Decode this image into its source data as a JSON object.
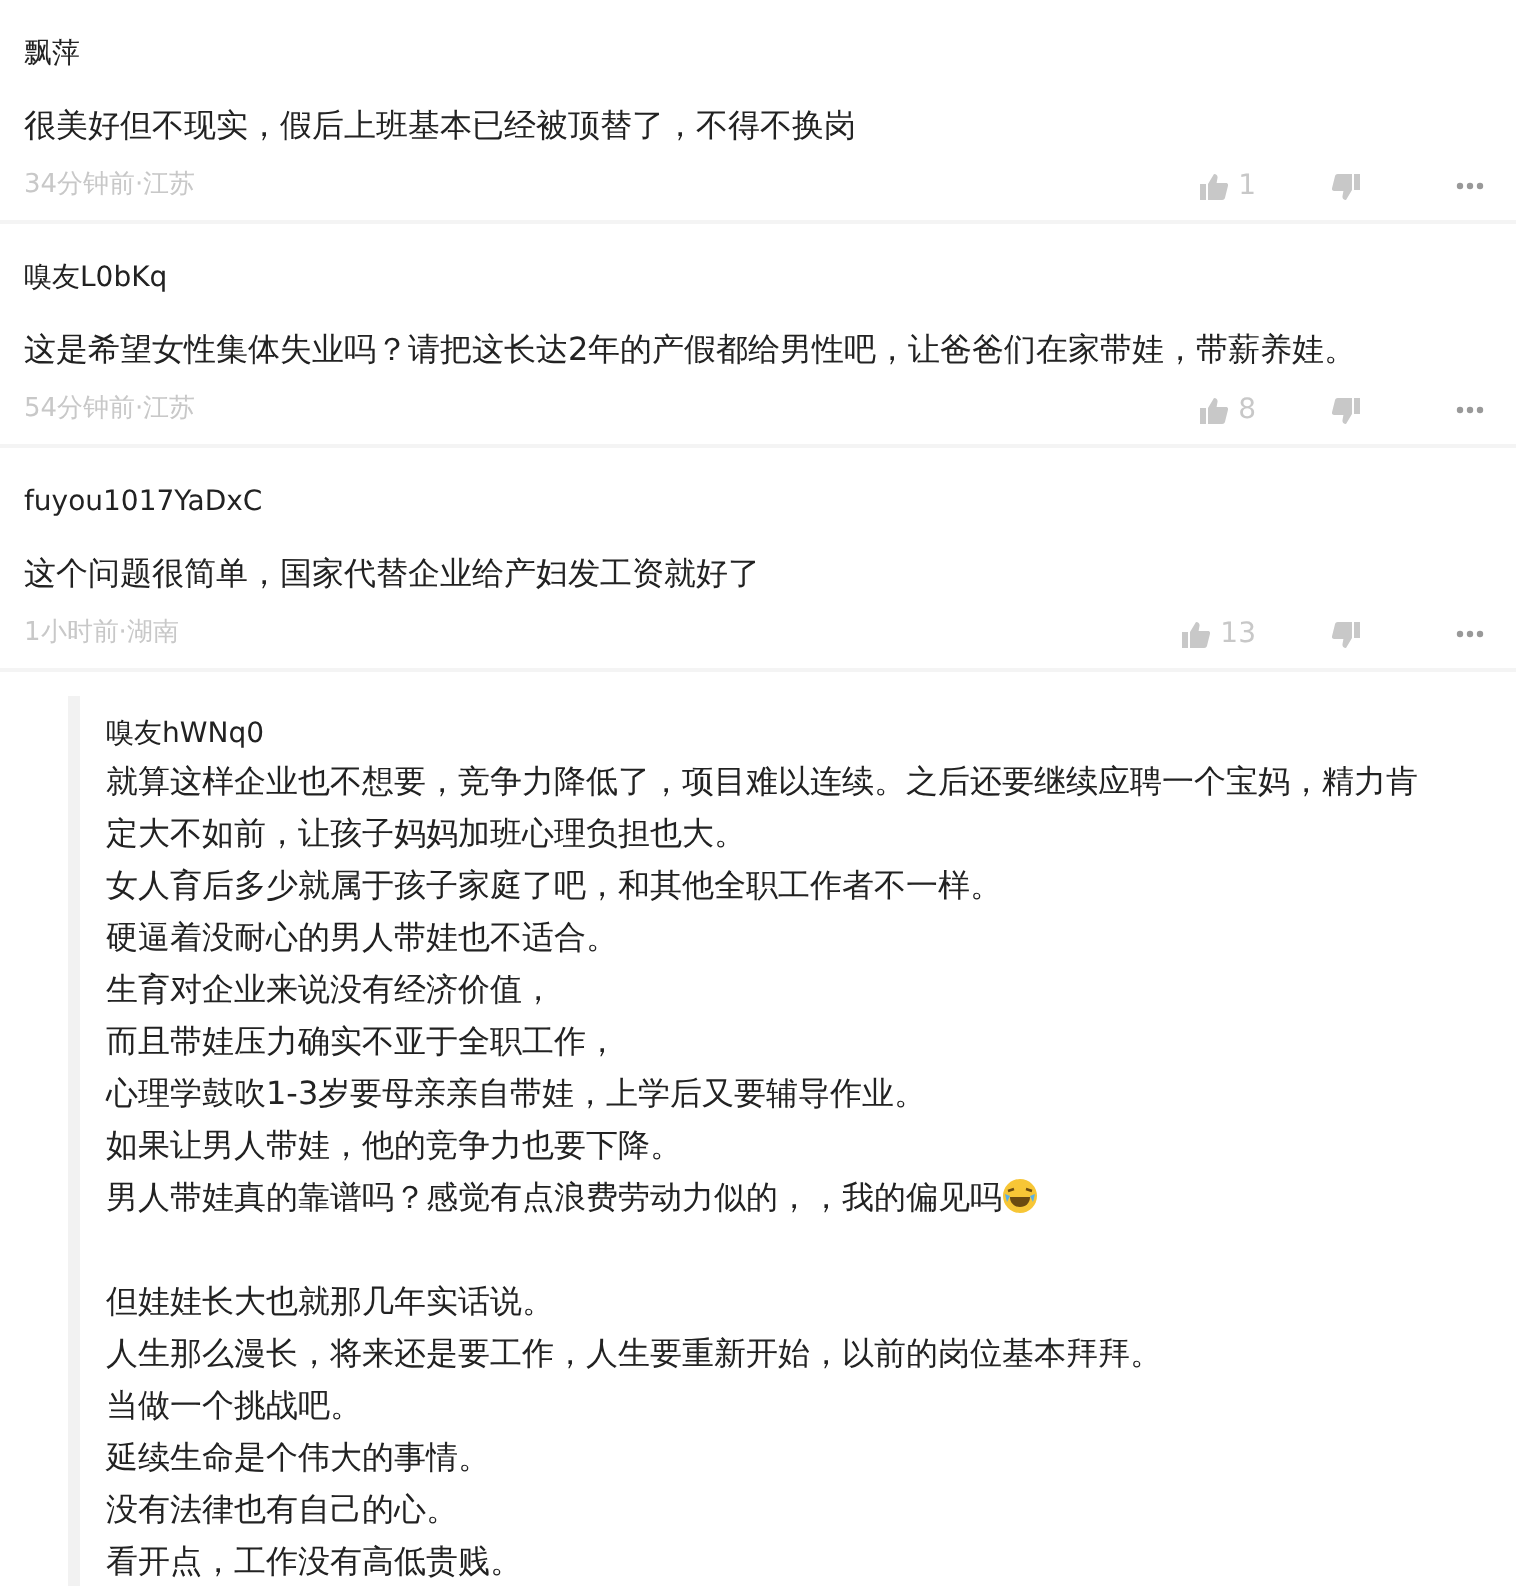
{
  "comments": [
    {
      "user": "飘萍",
      "text": "很美好但不现实，假后上班基本已经被顶替了，不得不换岗",
      "meta": "34分钟前·江苏",
      "likes": "1"
    },
    {
      "user": "嗅友L0bKq",
      "text": "这是希望女性集体失业吗？请把这长达2年的产假都给男性吧，让爸爸们在家带娃，带薪养娃。",
      "meta": "54分钟前·江苏",
      "likes": "8"
    },
    {
      "user": "fuyou1017YaDxC",
      "text": "这个问题很简单，国家代替企业给产妇发工资就好了",
      "meta": "1小时前·湖南",
      "likes": "13"
    }
  ],
  "reply": {
    "user": "嗅友hWNq0",
    "paragraphs": [
      [
        {
          "text": "就算这样企业也不想要，竞争力降低了，项目难以连续。之后还要继续应聘一个宝妈，精力肯定大不如前，让孩子妈妈加班心理负担也大。"
        },
        {
          "text": "女人育后多少就属于孩子家庭了吧，和其他全职工作者不一样。"
        },
        {
          "text": "硬逼着没耐心的男人带娃也不适合。"
        },
        {
          "text": "生育对企业来说没有经济价值，"
        },
        {
          "text": "而且带娃压力确实不亚于全职工作，"
        },
        {
          "text": "心理学鼓吹1-3岁要母亲亲自带娃，上学后又要辅导作业。"
        },
        {
          "text": "如果让男人带娃，他的竞争力也要下降。"
        },
        {
          "text": "男人带娃真的靠谱吗？感觉有点浪费劳动力似的，，我的偏见吗",
          "emoji": true
        }
      ],
      [
        {
          "text": "但娃娃长大也就那几年实话说。"
        },
        {
          "text": "人生那么漫长，将来还是要工作，人生要重新开始，以前的岗位基本拜拜。"
        },
        {
          "text": "当做一个挑战吧。"
        },
        {
          "text": "延续生命是个伟大的事情。"
        },
        {
          "text": "没有法律也有自己的心。"
        },
        {
          "text": "看开点，工作没有高低贵贱。"
        }
      ]
    ]
  }
}
